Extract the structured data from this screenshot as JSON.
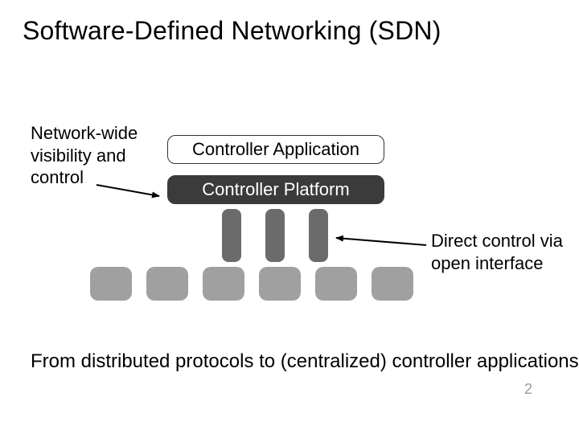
{
  "title": "Software-Defined Networking (SDN)",
  "left_label": "Network-wide\nvisibility and\ncontrol",
  "right_label": "Direct control via\nopen interface",
  "layers": {
    "application": "Controller Application",
    "platform": "Controller Platform"
  },
  "footer": "From distributed protocols to (centralized) controller applications",
  "page_number": "2",
  "colors": {
    "platform_bg": "#3b3b3b",
    "pipe": "#6b6b6b",
    "switch": "#a0a0a0",
    "page_num": "#9a9a9a"
  }
}
